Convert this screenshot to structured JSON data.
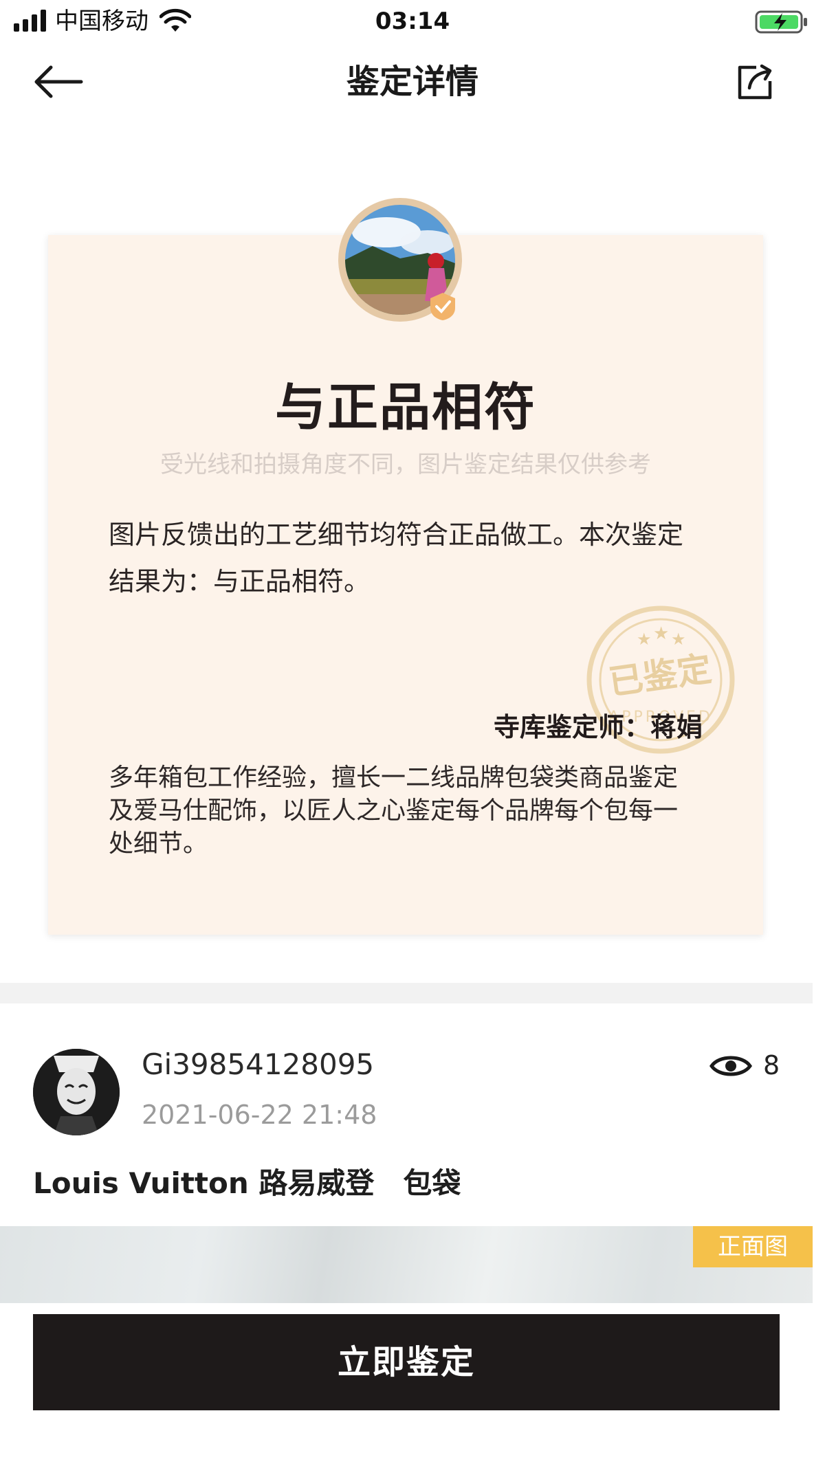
{
  "status_bar": {
    "carrier": "中国移动",
    "time": "03:14",
    "signal_icon": "cellular-signal-icon",
    "wifi_icon": "wifi-icon",
    "battery_icon": "battery-charging-icon"
  },
  "nav": {
    "title": "鉴定详情",
    "back_icon": "back-arrow-icon",
    "share_icon": "share-icon"
  },
  "certificate": {
    "result": "与正品相符",
    "notice": "受光线和拍摄角度不同，图片鉴定结果仅供参考",
    "description": "图片反馈出的工艺细节均符合正品做工。本次鉴定结果为：与正品相符。",
    "seal_text": "已鉴定",
    "seal_subtext": "APPROVED",
    "appraiser": "寺库鉴定师：蒋娟",
    "bio": "多年箱包工作经验，擅长一二线品牌包袋类商品鉴定及爱马仕配饰，以匠人之心鉴定每个品牌每个包每一处细节。",
    "colors": {
      "card_bg": "#fdf3ea",
      "seal": "#e8cfa0"
    }
  },
  "post": {
    "username": "Gi39854128095",
    "time": "2021-06-22 21:48",
    "views": "8",
    "view_icon": "eye-icon",
    "brand_category": "Louis Vuitton 路易威登　包袋",
    "photo_tag": "正面图"
  },
  "cta": {
    "label": "立即鉴定",
    "color": "#1e1a1a"
  }
}
